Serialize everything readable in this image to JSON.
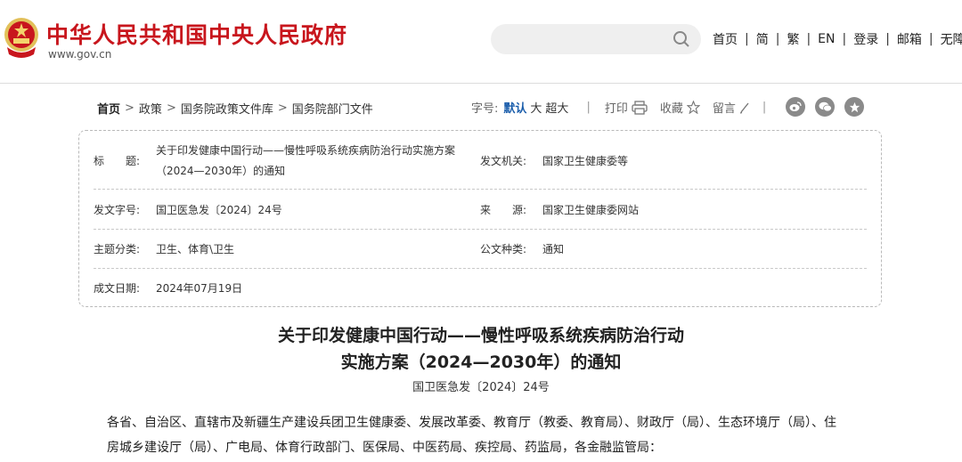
{
  "header": {
    "site_title": "中华人民共和国中央人民政府",
    "site_url": "www.gov.cn",
    "search": {
      "placeholder": ""
    },
    "nav": [
      "首页",
      "简",
      "繁",
      "EN",
      "登录",
      "邮箱",
      "无障"
    ],
    "brand_color": "#c8161d"
  },
  "breadcrumb": [
    "首页",
    "政策",
    "国务院政策文件库",
    "国务院部门文件"
  ],
  "tools": {
    "font_size_label": "字号:",
    "font_sizes": [
      "默认",
      "大",
      "超大"
    ],
    "print_label": "打印",
    "favorite_label": "收藏",
    "comment_label": "留言",
    "share_icons": [
      "weibo-icon",
      "wechat-icon",
      "star-icon"
    ]
  },
  "info": {
    "title_label": "标　　题:",
    "title_value_line1": "关于印发健康中国行动——慢性呼吸系统疾病防治行动实施方案",
    "title_value_line2": "（2024—2030年）的通知",
    "issuer_label": "发文机关:",
    "issuer_value": "国家卫生健康委等",
    "doc_no_label": "发文字号:",
    "doc_no_value": "国卫医急发〔2024〕24号",
    "source_label": "来　　源:",
    "source_value": "国家卫生健康委网站",
    "topic_label": "主题分类:",
    "topic_value": "卫生、体育\\卫生",
    "type_label": "公文种类:",
    "type_value": "通知",
    "date_label": "成文日期:",
    "date_value": "2024年07月19日"
  },
  "article": {
    "title_line1": "关于印发健康中国行动——慢性呼吸系统疾病防治行动",
    "title_line2": "实施方案（2024—2030年）的通知",
    "doc_number": "国卫医急发〔2024〕24号",
    "body_line1": "各省、自治区、直辖市及新疆生产建设兵团卫生健康委、发展改革委、教育厅（教委、教育局）、财政厅（局）、生态环境厅（局）、住",
    "body_line2": "房城乡建设厅（局）、广电局、体育行政部门、医保局、中医药局、疾控局、药监局，各金融监管局："
  }
}
